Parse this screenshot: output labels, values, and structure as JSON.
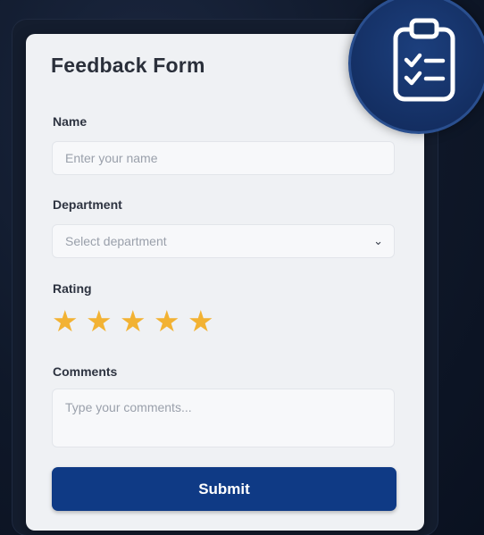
{
  "form": {
    "title": "Feedback Form",
    "name_label": "Name",
    "name_placeholder": "Enter your name",
    "department_label": "Department",
    "department_value": "Select department",
    "rating_label": "Rating",
    "rating_value": 5,
    "rating_max": 5,
    "comments_label": "Comments",
    "comments_placeholder": "Type your comments...",
    "submit_label": "Submit"
  },
  "icons": {
    "badge": "clipboard-checklist-icon",
    "dropdown": "chevron-down-icon",
    "star": "star-icon"
  },
  "colors": {
    "accent": "#0f3a85",
    "star": "#f2b233",
    "card": "#eff1f4",
    "background": "#0f1829"
  }
}
